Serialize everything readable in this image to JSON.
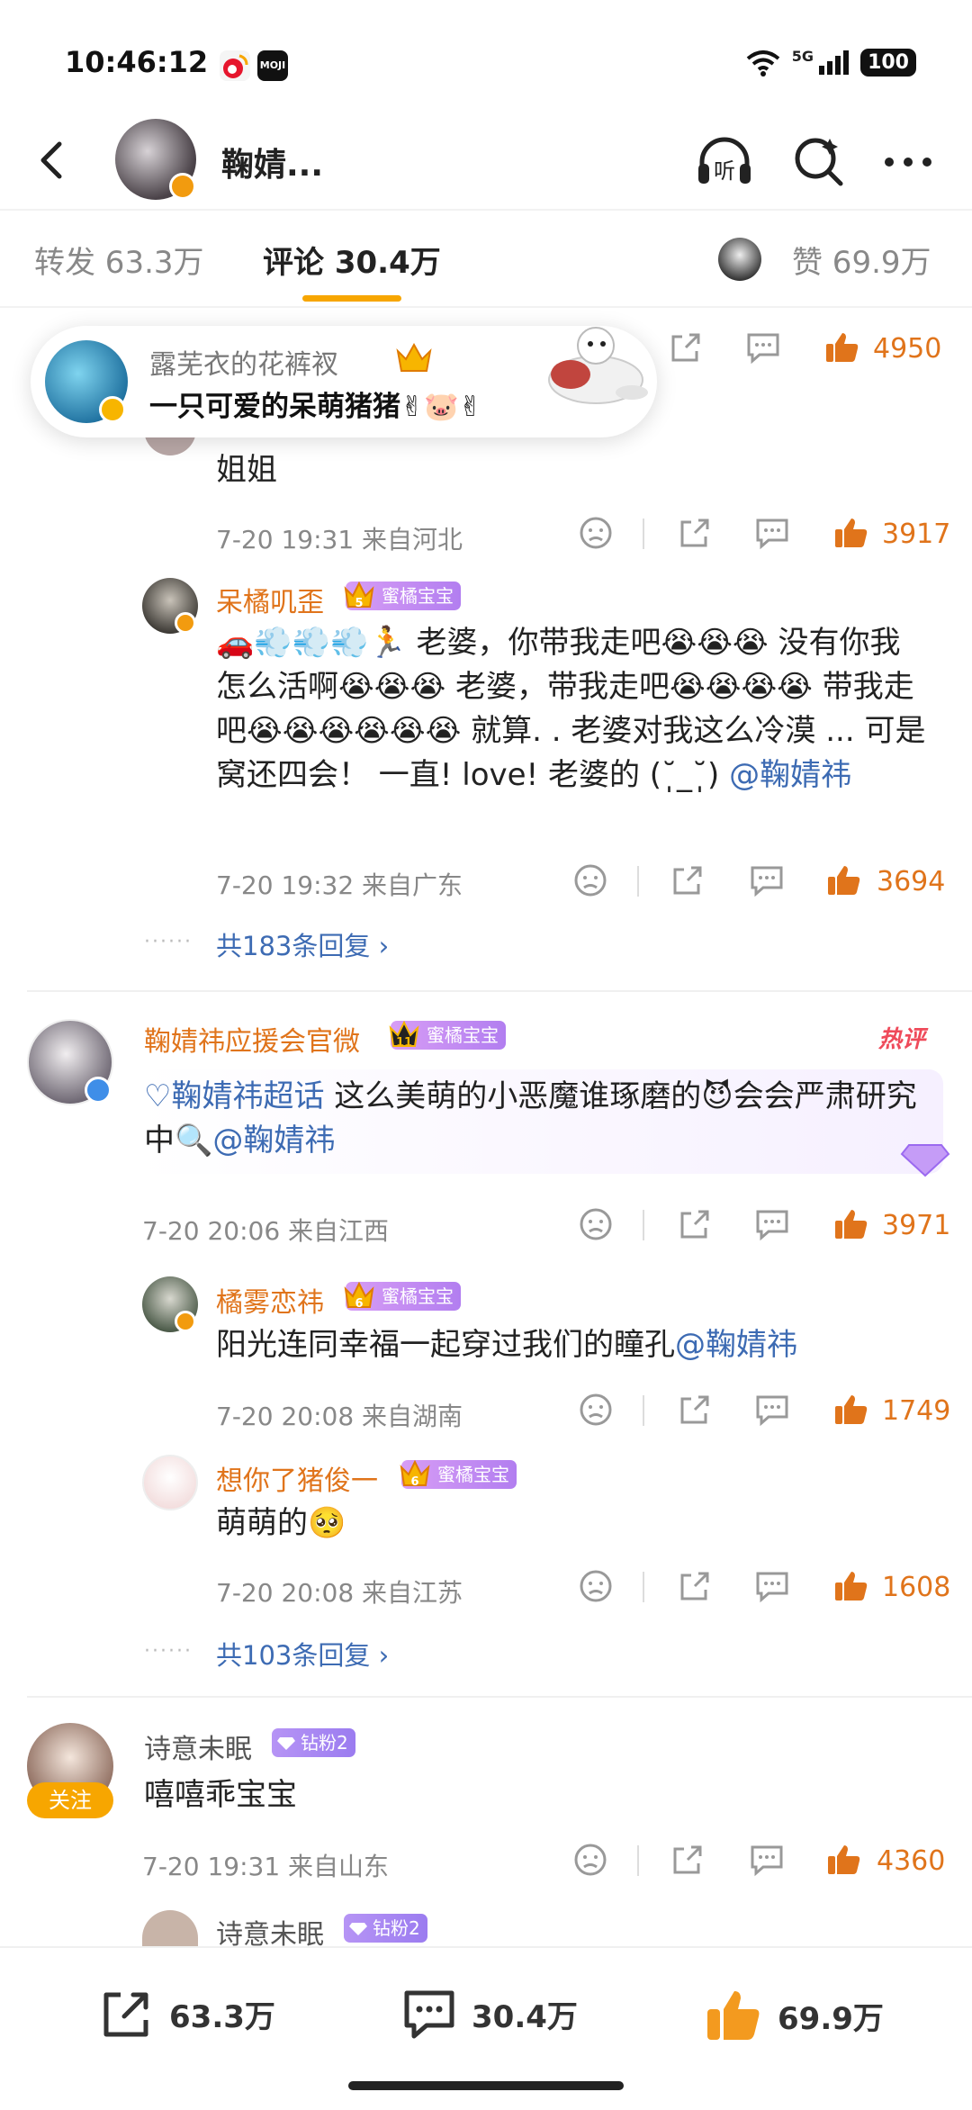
{
  "status": {
    "time": "10:46:12",
    "network": "5G",
    "battery": "100",
    "app_icon_2": "MOJI"
  },
  "header": {
    "title": "鞠婧...",
    "listen_label": "听"
  },
  "tabs": {
    "repost": "转发 63.3万",
    "comments": "评论 30.4万",
    "likes": "赞 69.9万"
  },
  "toast": {
    "name": "露芜衣的花裤衩",
    "text": "一只可爱的呆萌猪猪✌🐷✌"
  },
  "fan_badge_label": "蜜橘宝宝",
  "hot_label": "热评",
  "comments": [
    {
      "like_count": "4950"
    },
    {
      "text": "姐姐",
      "time_loc": "7-20 19:31  来自河北",
      "like_count": "3917"
    },
    {
      "name": "呆橘叽歪",
      "text_part1": "🚗💨💨💨🏃 老婆，你带我走吧😭😭😭 没有你我怎么活啊😭😭😭 老婆，带我走吧😭😭😭😭 带我走吧😭😭😭😭😭😭 就算. . 老婆对我这么冷漠 ... 可是窝还四会！ 一直! love! 老婆的 (˘̩̩̩_˘̩̩̩) ",
      "mention": "@鞠婧祎",
      "time_loc": "7-20 19:32  来自广东",
      "like_count": "3694"
    },
    {
      "more": "共183条回复 ›"
    },
    {
      "name": "鞠婧祎应援会官微",
      "topic": "♡鞠婧祎超话",
      "text_part1": " 这么美萌的小恶魔谁琢磨的😈会会严肃研究中🔍",
      "mention": "@鞠婧祎",
      "time_loc": "7-20 20:06  来自江西",
      "like_count": "3971"
    },
    {
      "name": "橘雾恋祎",
      "text_part1": "阳光连同幸福一起穿过我们的瞳孔",
      "mention": "@鞠婧祎",
      "time_loc": "7-20 20:08  来自湖南",
      "like_count": "1749"
    },
    {
      "name": "想你了猪俊一",
      "text_part1": "萌萌的🥺",
      "time_loc": "7-20 20:08  来自江苏",
      "like_count": "1608"
    },
    {
      "more": "共103条回复 ›"
    },
    {
      "name": "诗意未眠",
      "badge": "钻粉2",
      "follow": "关注",
      "text_part1": "嘻嘻乖宝宝",
      "time_loc": "7-20 19:31  来自山东",
      "like_count": "4360"
    },
    {
      "name": "诗意未眠",
      "badge": "钻粉2"
    }
  ],
  "bottom": {
    "repost": "63.3万",
    "comment": "30.4万",
    "like": "69.9万"
  },
  "colors": {
    "accent": "#e0741b",
    "mention": "#3d6bb3",
    "tab_underline": "#f7a600"
  }
}
